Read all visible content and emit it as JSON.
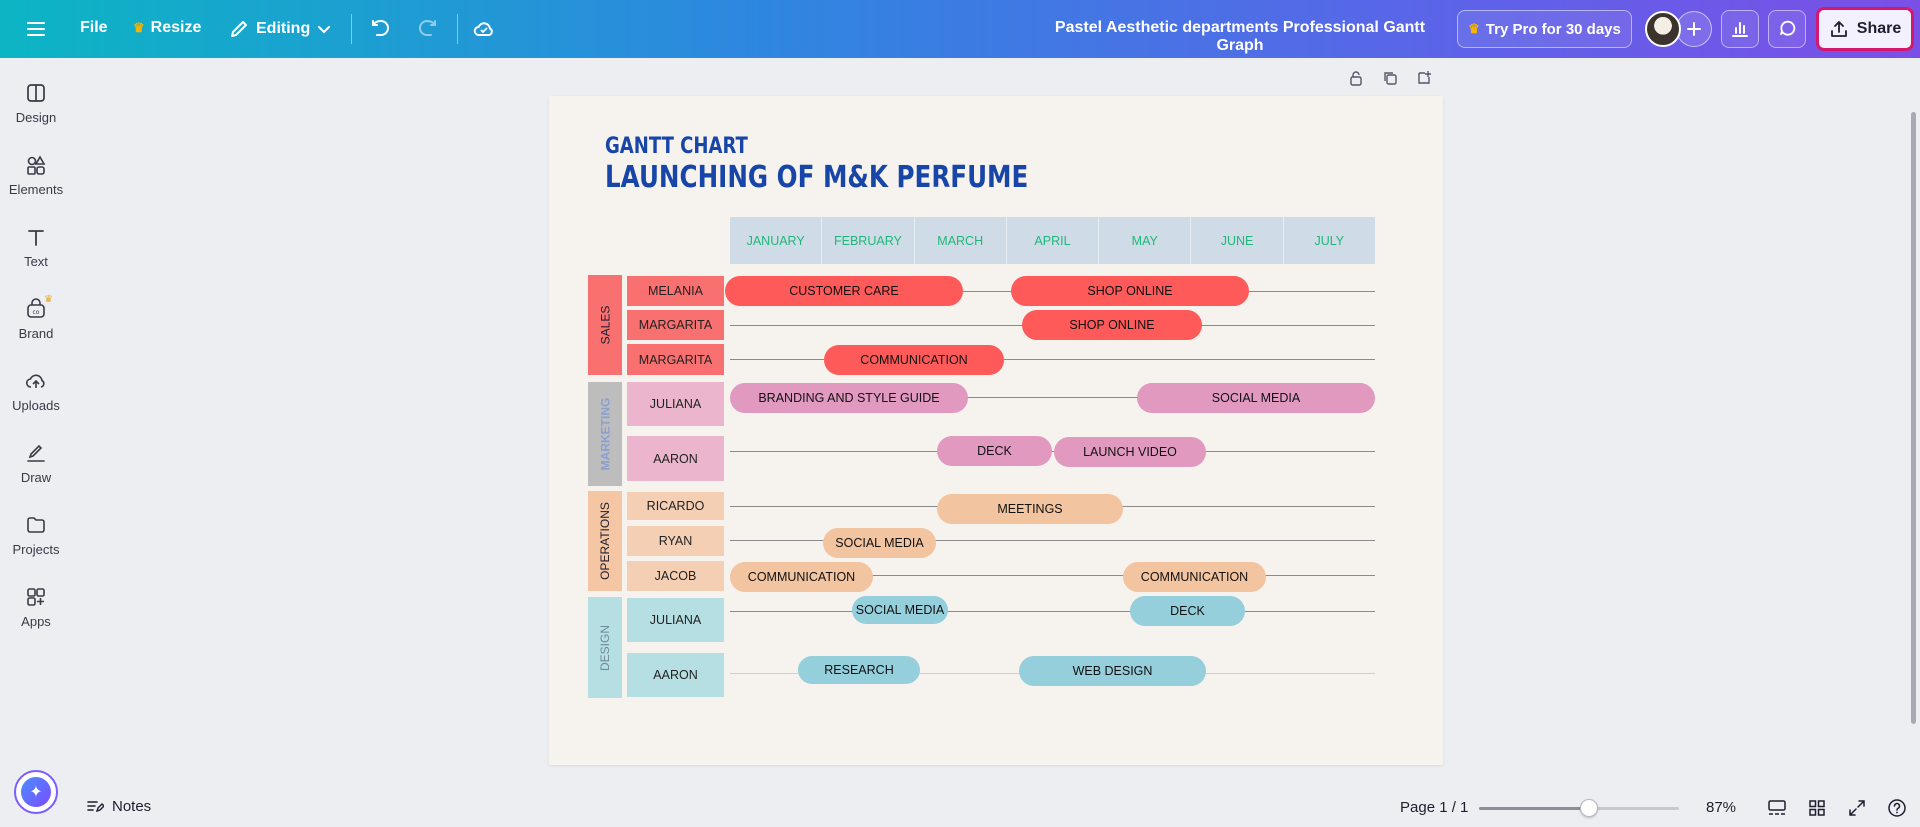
{
  "topbar": {
    "file_label": "File",
    "resize_label": "Resize",
    "editing_label": "Editing",
    "doc_title": "Pastel Aesthetic departments Professional Gantt Graph",
    "try_pro_label": "Try Pro for 30 days",
    "share_label": "Share"
  },
  "sidebar": {
    "items": [
      {
        "label": "Design",
        "icon": "design-icon"
      },
      {
        "label": "Elements",
        "icon": "elements-icon"
      },
      {
        "label": "Text",
        "icon": "text-icon"
      },
      {
        "label": "Brand",
        "icon": "brand-icon"
      },
      {
        "label": "Uploads",
        "icon": "uploads-icon"
      },
      {
        "label": "Draw",
        "icon": "draw-icon"
      },
      {
        "label": "Projects",
        "icon": "projects-icon"
      },
      {
        "label": "Apps",
        "icon": "apps-icon"
      }
    ]
  },
  "gantt": {
    "subtitle": "GANTT CHART",
    "title": "LAUNCHING OF M&K PERFUME",
    "months": [
      "JANUARY",
      "FEBRUARY",
      "MARCH",
      "APRIL",
      "MAY",
      "JUNE",
      "JULY"
    ],
    "departments": [
      {
        "name": "SALES",
        "color": "#f97070",
        "text_color": "#1e1e2e"
      },
      {
        "name": "MARKETING",
        "color": "#bdbdbd",
        "text_color": "#8aa0cf"
      },
      {
        "name": "OPERATIONS",
        "color": "#f4c6a4",
        "text_color": "#1e1e2e"
      },
      {
        "name": "DESIGN",
        "color": "#b6dfe3",
        "text_color": "#6f8a9c"
      }
    ],
    "rows": [
      {
        "name": "MELANIA",
        "dept": "SALES"
      },
      {
        "name": "MARGARITA",
        "dept": "SALES"
      },
      {
        "name": "MARGARITA",
        "dept": "SALES"
      },
      {
        "name": "JULIANA",
        "dept": "MARKETING"
      },
      {
        "name": "AARON",
        "dept": "MARKETING"
      },
      {
        "name": "RICARDO",
        "dept": "OPERATIONS"
      },
      {
        "name": "RYAN",
        "dept": "OPERATIONS"
      },
      {
        "name": "JACOB",
        "dept": "OPERATIONS"
      },
      {
        "name": "JULIANA",
        "dept": "DESIGN"
      },
      {
        "name": "AARON",
        "dept": "DESIGN"
      }
    ],
    "tasks": [
      {
        "label": "CUSTOMER CARE"
      },
      {
        "label": "SHOP ONLINE"
      },
      {
        "label": "SHOP ONLINE"
      },
      {
        "label": "COMMUNICATION"
      },
      {
        "label": "BRANDING AND STYLE GUIDE"
      },
      {
        "label": "SOCIAL MEDIA"
      },
      {
        "label": "DECK"
      },
      {
        "label": "LAUNCH VIDEO"
      },
      {
        "label": "MEETINGS"
      },
      {
        "label": "SOCIAL MEDIA"
      },
      {
        "label": "COMMUNICATION"
      },
      {
        "label": "COMMUNICATION"
      },
      {
        "label": "SOCIAL MEDIA"
      },
      {
        "label": "DECK"
      },
      {
        "label": "RESEARCH"
      },
      {
        "label": "WEB DESIGN"
      }
    ]
  },
  "statusbar": {
    "notes_label": "Notes",
    "page_label": "Page 1 / 1",
    "zoom_label": "87%",
    "zoom_level": 0.55
  },
  "colors": {
    "sales": "#fe5a5a",
    "marketing": "#e199bf",
    "operations": "#f3c4a0",
    "design": "#94cfdb",
    "share_highlight": "#d6176f"
  }
}
